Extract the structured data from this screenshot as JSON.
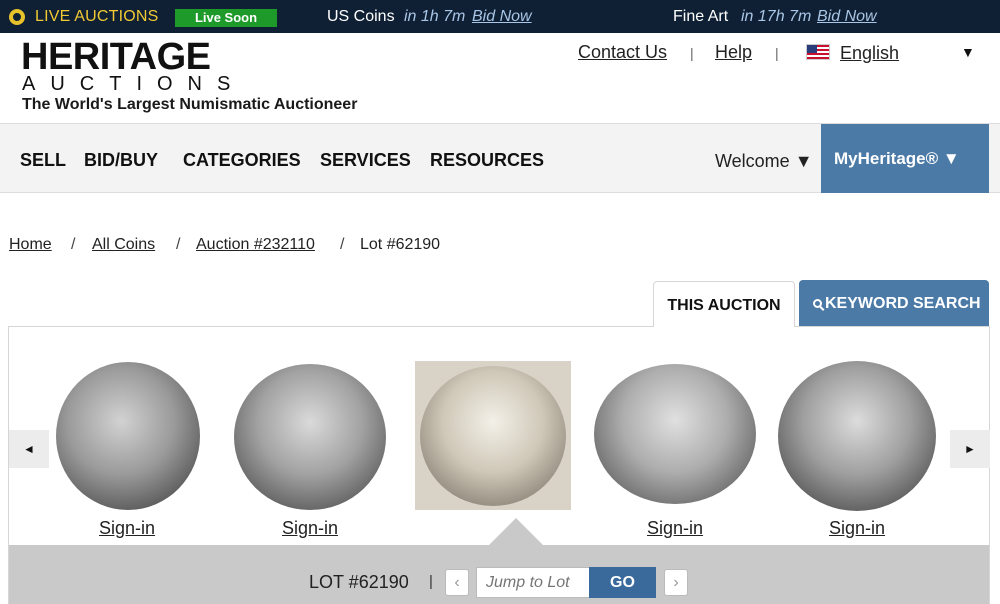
{
  "livebar": {
    "label": "LIVE AUCTIONS",
    "badge": "Live Soon",
    "events": [
      {
        "title": "US Coins",
        "time": "in 1h 7m",
        "bid": "Bid Now"
      },
      {
        "title": "Fine Art",
        "time": "in 17h 7m",
        "bid": "Bid Now"
      }
    ]
  },
  "header": {
    "logo_main": "HERITAGE",
    "logo_sub": "AUCTIONS",
    "tagline": "The World's Largest Numismatic Auctioneer",
    "contact": "Contact Us",
    "help": "Help",
    "separator": "|",
    "language": "English"
  },
  "nav": {
    "items": [
      "SELL",
      "BID/BUY",
      "CATEGORIES",
      "SERVICES",
      "RESOURCES"
    ],
    "welcome": "Welcome ▼",
    "myheritage": "MyHeritage® ▼"
  },
  "breadcrumb": {
    "home": "Home",
    "all_coins": "All Coins",
    "auction": "Auction #232110",
    "lot": "Lot #62190",
    "sep": "/"
  },
  "tabs": {
    "this_auction": "THIS AUCTION",
    "keyword_search": "KEYWORD SEARCH"
  },
  "carousel": {
    "prev": "◄",
    "next": "►",
    "items": [
      {
        "label": "Sign-in"
      },
      {
        "label": "Sign-in"
      },
      {
        "label": ""
      },
      {
        "label": "Sign-in"
      },
      {
        "label": "Sign-in"
      }
    ]
  },
  "lotnav": {
    "label": "LOT #62190",
    "sep": "|",
    "prev": "‹",
    "next": "›",
    "jump_placeholder": "Jump to Lot",
    "go": "GO"
  },
  "colors": {
    "livebar_bg": "#0f2034",
    "live_label": "#f0c933",
    "badge_green": "#1e9a2a",
    "accent_blue": "#4b7aa6",
    "go_blue": "#3a6a9c"
  }
}
